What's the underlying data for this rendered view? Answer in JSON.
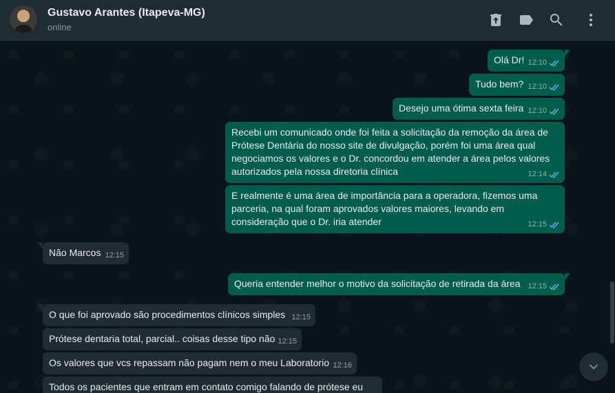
{
  "header": {
    "contact_name": "Gustavo Arantes (Itapeva-MG)",
    "status": "online",
    "icons": [
      "delete-icon",
      "label-icon",
      "search-icon",
      "menu-icon"
    ]
  },
  "messages": [
    {
      "dir": "out",
      "text": "Olá Dr!",
      "time": "12:10",
      "read": true
    },
    {
      "dir": "out",
      "text": "Tudo bem?",
      "time": "12:10",
      "read": true
    },
    {
      "dir": "out",
      "text": "Desejo uma ótima sexta feira",
      "time": "12:10",
      "read": true
    },
    {
      "dir": "out",
      "text": "Recebi um comunicado onde foi feita a solicitação da remoção da área de Prótese Dentária do nosso site de divulgação, porém foi uma área qual negociamos os valores e o Dr. concordou em atender a área pelos valores autorizados pela nossa diretoria clínica",
      "time": "12:14",
      "read": true
    },
    {
      "dir": "out",
      "text": "E realmente é uma área de importância para a operadora, fizemos uma parceria, na qual foram aprovados valores maiores, levando em consideração que o Dr. iria atender",
      "time": "12:15",
      "read": true
    },
    {
      "dir": "in",
      "text": "Não Marcos",
      "time": "12:15"
    },
    {
      "dir": "out",
      "text": "Queria entender melhor o motivo da solicitação de retirada da área",
      "time": "12:15",
      "read": true
    },
    {
      "dir": "in",
      "text": "O que foi aprovado são procedimentos clínicos simples",
      "time": "12:15"
    },
    {
      "dir": "in",
      "text": "Prótese dentaria total, parcial.. coisas desse tipo não",
      "time": "12:15"
    },
    {
      "dir": "in",
      "text": "Os valores que vcs repassam não pagam nem o meu Laboratorio",
      "time": "12:16"
    },
    {
      "dir": "in",
      "text": "Todos os pacientes que entram em contato comigo falando de prótese eu",
      "time": ""
    }
  ],
  "colors": {
    "outgoing_bubble": "#005c4b",
    "incoming_bubble": "#202c33",
    "read_ticks": "#53bdeb",
    "background": "#0b141a"
  }
}
